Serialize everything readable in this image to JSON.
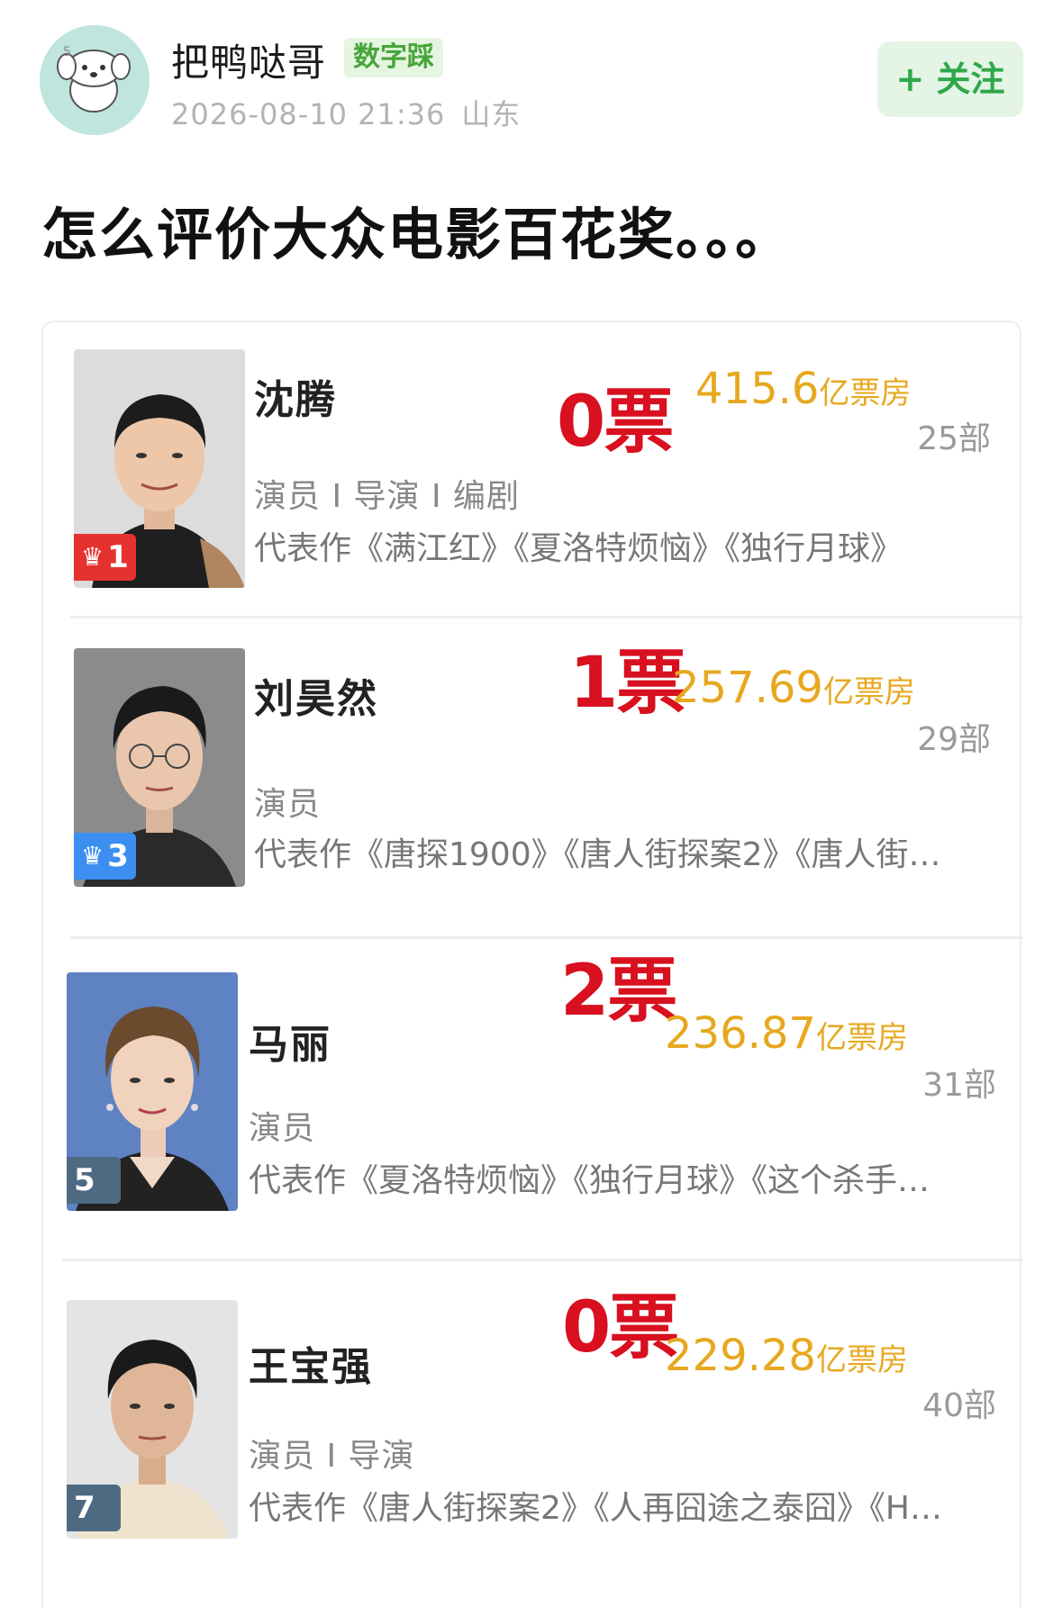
{
  "header": {
    "user_name": "把鸭哒哥",
    "badge": "数字踩",
    "timestamp": "2026-08-10 21:36",
    "location": "山东",
    "follow_label": "+ 关注"
  },
  "post": {
    "title": "怎么评价大众电影百花奖。。。"
  },
  "entries": [
    {
      "name": "沈腾",
      "rank": "1",
      "rank_color": "#e6322e",
      "crown": true,
      "roles": "演员 I 导演 I 编剧",
      "works": "代表作《满江红》《夏洛特烦恼》《独行月球》",
      "votes": "0票",
      "boxoffice_value": "415.6",
      "boxoffice_unit": "亿票房",
      "film_count": "25部"
    },
    {
      "name": "刘昊然",
      "rank": "3",
      "rank_color": "#3c8ff0",
      "crown": true,
      "roles": "演员",
      "works": "代表作《唐探1900》《唐人街探案2》《唐人街…",
      "votes": "1票",
      "boxoffice_value": "257.69",
      "boxoffice_unit": "亿票房",
      "film_count": "29部"
    },
    {
      "name": "马丽",
      "rank": "5",
      "rank_color": "#4e6a82",
      "crown": false,
      "roles": "演员",
      "works": "代表作《夏洛特烦恼》《独行月球》《这个杀手…",
      "votes": "2票",
      "boxoffice_value": "236.87",
      "boxoffice_unit": "亿票房",
      "film_count": "31部"
    },
    {
      "name": "王宝强",
      "rank": "7",
      "rank_color": "#4e6a82",
      "crown": false,
      "roles": "演员 I 导演",
      "works": "代表作《唐人街探案2》《人再囧途之泰囧》《H…",
      "votes": "0票",
      "boxoffice_value": "229.28",
      "boxoffice_unit": "亿票房",
      "film_count": "40部"
    }
  ],
  "icons": {
    "crown": "crown-icon",
    "avatar": "cartoon-dog-avatar"
  }
}
